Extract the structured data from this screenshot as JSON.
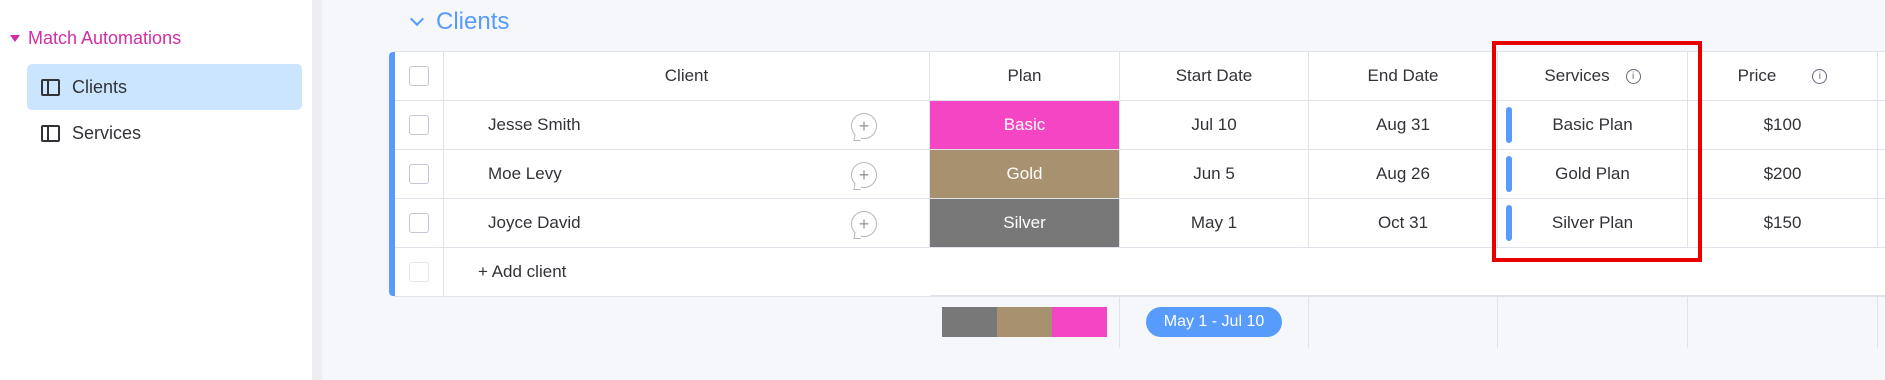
{
  "sidebar": {
    "workspace_title": "Match Automations",
    "items": [
      {
        "label": "Clients",
        "active": true,
        "icon": "board-icon"
      },
      {
        "label": "Services",
        "active": false,
        "icon": "board-icon"
      }
    ]
  },
  "group": {
    "title": "Clients",
    "color": "#579bfc"
  },
  "table": {
    "columns": {
      "client": "Client",
      "plan": "Plan",
      "start": "Start Date",
      "end": "End Date",
      "services": "Services",
      "price": "Price"
    },
    "rows": [
      {
        "client": "Jesse Smith",
        "plan": "Basic",
        "plan_color": "#f445c4",
        "start": "Jul 10",
        "end": "Aug 31",
        "service": "Basic Plan",
        "price": "$100"
      },
      {
        "client": "Moe Levy",
        "plan": "Gold",
        "plan_color": "#a8916f",
        "start": "Jun 5",
        "end": "Aug 26",
        "service": "Gold Plan",
        "price": "$200"
      },
      {
        "client": "Joyce David",
        "plan": "Silver",
        "plan_color": "#787878",
        "start": "May 1",
        "end": "Oct 31",
        "service": "Silver Plan",
        "price": "$150"
      }
    ],
    "add_row_label": "+ Add client"
  },
  "summary": {
    "plan_distribution": [
      {
        "color": "#787878",
        "fraction": 0.333
      },
      {
        "color": "#a8916f",
        "fraction": 0.333
      },
      {
        "color": "#f445c4",
        "fraction": 0.334
      }
    ],
    "timeline": "May 1 - Jul 10"
  },
  "annotation": {
    "color": "#e80000"
  }
}
